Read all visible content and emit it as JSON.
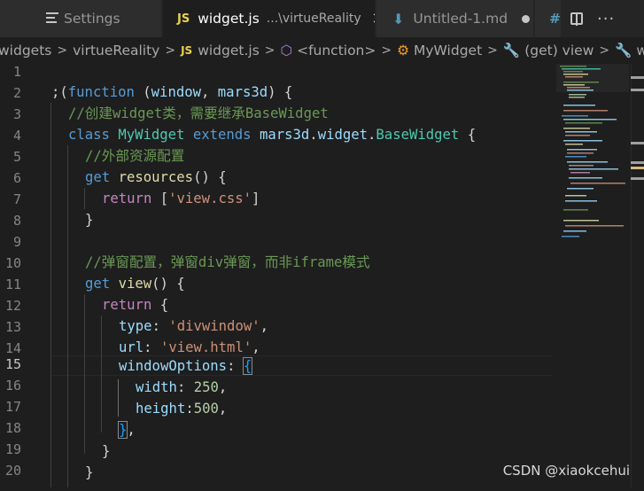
{
  "tabs": [
    {
      "id": "settings",
      "label": "Settings"
    },
    {
      "id": "widget",
      "badge": "JS",
      "label": "widget.js",
      "path": "...\\virtueReality",
      "close": "✕"
    },
    {
      "id": "untitled",
      "label": "Untitled-1.md"
    },
    {
      "id": "hash",
      "label": "#"
    }
  ],
  "breadcrumb": [
    "widgets",
    "virtueReality",
    "widget.js",
    "<function>",
    "MyWidget",
    "(get) view",
    "window"
  ],
  "line_numbers": [
    "1",
    "2",
    "3",
    "4",
    "5",
    "6",
    "7",
    "8",
    "9",
    "10",
    "11",
    "12",
    "13",
    "14",
    "15",
    "16",
    "17",
    "18",
    "19",
    "20"
  ],
  "current_line": "15",
  "code": {
    "l2": [
      ";(",
      "function",
      " (",
      "window",
      ", ",
      "mars3d",
      ") {"
    ],
    "l3": "//创建widget类，需要继承BaseWidget",
    "l4": [
      "class",
      " ",
      "MyWidget",
      " ",
      "extends",
      " ",
      "mars3d",
      ".",
      "widget",
      ".",
      "BaseWidget",
      " {"
    ],
    "l5": "//外部资源配置",
    "l6": [
      "get",
      " ",
      "resources",
      "() {"
    ],
    "l7": [
      "return",
      " [",
      "'view.css'",
      "]"
    ],
    "l8": "}",
    "l10": "//弹窗配置，弹窗div弹窗，而非iframe模式",
    "l11": [
      "get",
      " ",
      "view",
      "() {"
    ],
    "l12": [
      "return",
      " {"
    ],
    "l13": [
      "type",
      ": ",
      "'divwindow'",
      ","
    ],
    "l14": [
      "url",
      ": ",
      "'view.html'",
      ","
    ],
    "l15": [
      "windowOptions",
      ": ",
      "{"
    ],
    "l16": [
      "width",
      ": ",
      "250",
      ","
    ],
    "l17": [
      "height",
      ":",
      "500",
      ","
    ],
    "l18": [
      "}",
      ","
    ],
    "l19": "}",
    "l20": "}"
  },
  "watermark": "CSDN @xiaokcehui",
  "icons": [
    "settings-icon",
    "js-file-icon",
    "close-icon",
    "markdown-file-icon",
    "unsaved-dot-icon",
    "split-editor-icon",
    "more-actions-icon",
    "cube-icon",
    "class-icon",
    "wrench-icon"
  ],
  "colors": {
    "keyword": "#569cd6",
    "function": "#dcdcaa",
    "variable": "#9cdcfe",
    "comment": "#6a9955",
    "string": "#ce9178",
    "class": "#4ec9b0",
    "number": "#b5cea8",
    "control": "#c586c0"
  }
}
